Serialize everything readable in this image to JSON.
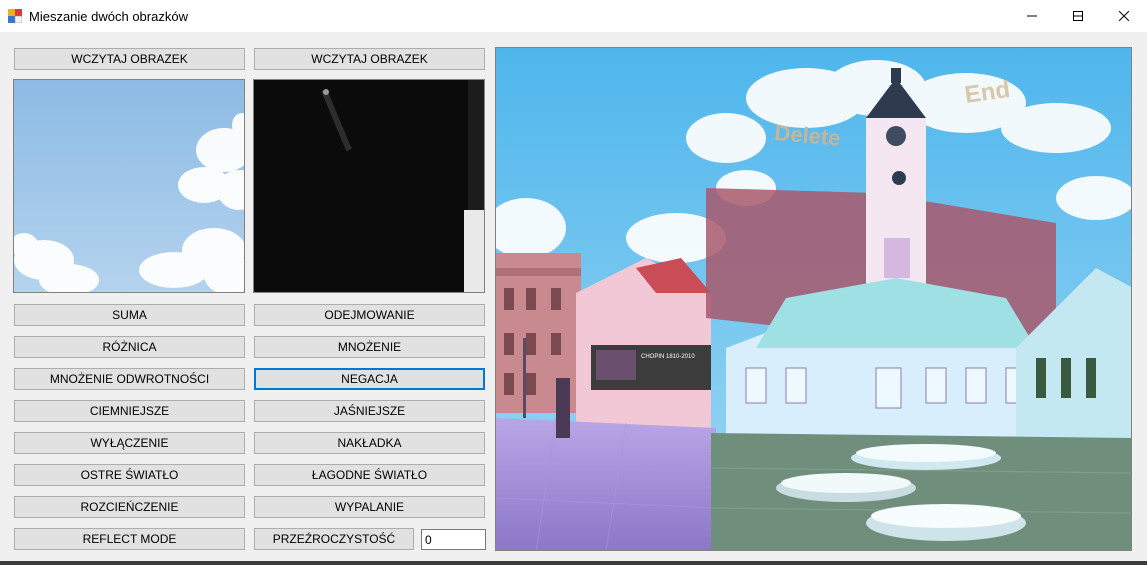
{
  "window": {
    "title": "Mieszanie dwóch obrazków"
  },
  "load_buttons": {
    "left": "WCZYTAJ OBRAZEK",
    "right": "WCZYTAJ OBRAZEK"
  },
  "blend_buttons": {
    "suma": "SUMA",
    "odejmowanie": "ODEJMOWANIE",
    "roznica": "RÓŻNICA",
    "mnozenie": "MNOŻENIE",
    "mnozenie_odwrotnosci": "MNOŻENIE ODWROTNOŚCI",
    "negacja": "NEGACJA",
    "ciemniejsze": "CIEMNIEJSZE",
    "jasniejsze": "JAŚNIEJSZE",
    "wylaczenie": "WYŁĄCZENIE",
    "nakladka": "NAKŁADKA",
    "ostre_swiatlo": "OSTRE ŚWIATŁO",
    "lagodne_swiatlo": "ŁAGODNE ŚWIATŁO",
    "rozcienczenie": "ROZCIEŃCZENIE",
    "wypalanie": "WYPALANIE",
    "reflect_mode": "REFLECT MODE",
    "przezroczystosc": "PRZEŹROCZYSTOŚĆ"
  },
  "opacity_value": "0",
  "result_image": {
    "overlay_words": [
      "Delete",
      "End"
    ]
  },
  "colors": {
    "focus_border": "#0078d7",
    "button_bg": "#e1e1e1",
    "window_bg": "#f0f0f0"
  }
}
